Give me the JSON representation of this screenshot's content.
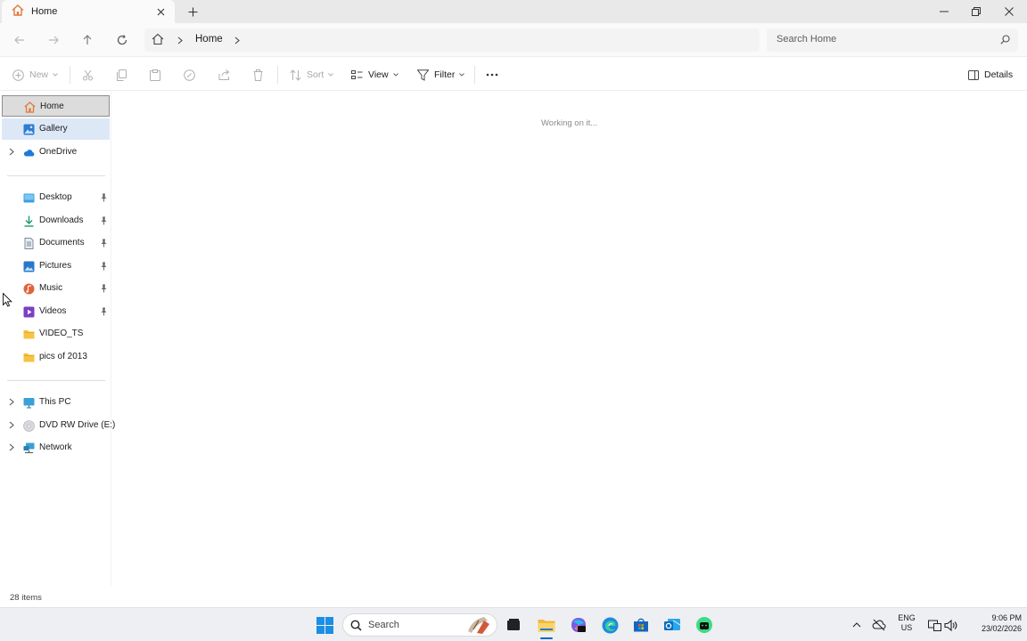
{
  "window": {
    "tab_title": "Home",
    "new_tab": "+"
  },
  "address": {
    "crumb": "Home",
    "search_placeholder": "Search Home"
  },
  "commands": {
    "new": "New",
    "sort": "Sort",
    "view": "View",
    "filter": "Filter",
    "details": "Details"
  },
  "sidebar": {
    "top": [
      {
        "label": "Home",
        "icon": "home-icon"
      },
      {
        "label": "Gallery",
        "icon": "gallery-icon"
      },
      {
        "label": "OneDrive",
        "icon": "cloud-icon"
      }
    ],
    "quick": [
      {
        "label": "Desktop",
        "icon": "desktop-icon",
        "pinned": true
      },
      {
        "label": "Downloads",
        "icon": "download-icon",
        "pinned": true
      },
      {
        "label": "Documents",
        "icon": "documents-icon",
        "pinned": true
      },
      {
        "label": "Pictures",
        "icon": "pictures-icon",
        "pinned": true
      },
      {
        "label": "Music",
        "icon": "music-icon",
        "pinned": true
      },
      {
        "label": "Videos",
        "icon": "videos-icon",
        "pinned": true
      },
      {
        "label": "VIDEO_TS",
        "icon": "folder-icon",
        "pinned": false
      },
      {
        "label": "pics of 2013",
        "icon": "folder-icon",
        "pinned": false
      }
    ],
    "drives": [
      {
        "label": "This PC",
        "icon": "pc-icon"
      },
      {
        "label": "DVD RW Drive (E:) ",
        "icon": "disc-icon"
      },
      {
        "label": "Network",
        "icon": "network-icon"
      }
    ]
  },
  "content": {
    "status": "Working on it..."
  },
  "statusbar": {
    "count": "28 items"
  },
  "taskbar": {
    "search": "Search",
    "lang_1": "ENG",
    "lang_2": "US",
    "time": "9:06 PM",
    "date": "23/02/2026"
  },
  "colors": {
    "accent": "#0067c0",
    "selection_bg": "#dcdcdc",
    "hover_bg": "#dde8f7",
    "folder": "#f6c343"
  }
}
